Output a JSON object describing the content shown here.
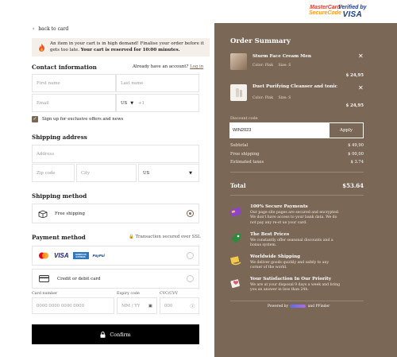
{
  "header": {
    "mastercard_line1": "MasterCard",
    "mastercard_line2": "SecureCode",
    "visa_line1": "Verified by",
    "visa_line2": "VISA"
  },
  "checkout": {
    "back_label": "back to card",
    "alert_text": "An item in your cart is in high demand! Finalise your order before it gets too late.",
    "alert_bold": "Your cart is reserved for 10:00 minutes.",
    "contact": {
      "title": "Contact information",
      "have_account": "Already have an account?",
      "login": "Log in",
      "first_name_placeholder": "First name",
      "last_name_placeholder": "Last name",
      "email_placeholder": "Email",
      "country_code": "US",
      "phone_prefix": "+1",
      "signup_label": "Sign up for exclusive offers and news"
    },
    "shipping_address": {
      "title": "Shipping address",
      "address_placeholder": "Address",
      "zip_placeholder": "Zip code",
      "city_placeholder": "City",
      "country_value": "US"
    },
    "shipping_method": {
      "title": "Shipping method",
      "option_label": "Free shipping"
    },
    "payment": {
      "title": "Payment method",
      "secure_note": "Transaction secured over SSL",
      "card_label": "Credit or debit card",
      "card_number_label": "Card number",
      "card_number_placeholder": "0000 0000 0000 0000",
      "expiry_label": "Expiry code",
      "expiry_placeholder": "MM / YY",
      "cvc_label": "CVC/CVV",
      "cvc_placeholder": "000",
      "brands": [
        "MC",
        "VISA",
        "AMERICAN EXPRESS",
        "PayPal"
      ]
    },
    "confirm_label": "Confirm"
  },
  "summary": {
    "title": "Order Summary",
    "items": [
      {
        "name": "Sturm Face Cream Men",
        "color": "Color: Pink",
        "size": "Size: S",
        "price": "$ 24,95"
      },
      {
        "name": "Duet Purifying Cleanser and tonic",
        "color": "Color: Pink",
        "size": "Size: S",
        "price": "$ 24,95"
      }
    ],
    "discount_label": "Discount code",
    "discount_value": "WIN2023",
    "apply_label": "Apply",
    "subtotal_label": "Subtotal",
    "subtotal_value": "$ 49,90",
    "shipping_label": "Free shipping",
    "shipping_value": "$ 00,00",
    "taxes_label": "Estimated taxes",
    "taxes_value": "$ 3.74",
    "total_label": "Total",
    "total_value": "$53.64",
    "features": [
      {
        "title": "100% Secure Payments",
        "desc": "Our page site pages are secured and encrypted. We don't have access to your bank data. We do not pay any re-st ue your card."
      },
      {
        "title": "The Best Prices",
        "desc": "We constantly offer seasonal discounts and a bonus system."
      },
      {
        "title": "Worldwide Shipping",
        "desc": "We deliver goods quickly and safely to any corner of the world."
      },
      {
        "title": "Your Satisfaction In Our Priority",
        "desc": "We are at your disposal 9 days a week and bring you an answer in less than 24h."
      }
    ],
    "powered_prefix": "Powered by",
    "powered_suffix": "and PFinder"
  },
  "colors": {
    "panel": "#7a6756",
    "accent": "#7a6756",
    "button": "#000000"
  }
}
